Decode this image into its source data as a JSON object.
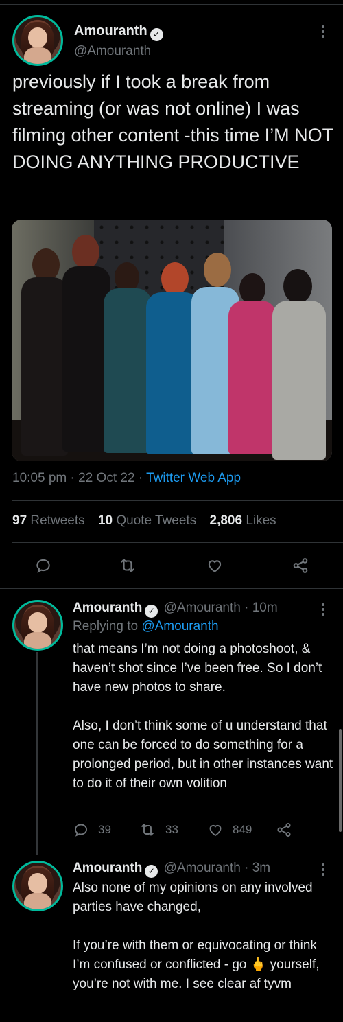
{
  "tweet": {
    "author_name": "Amouranth",
    "author_handle": "@Amouranth",
    "text": "previously if I took a break from streaming (or was not online) I was filming other content -this time I’M NOT DOING ANYTHING PRODUCTIVE",
    "time": "10:05 pm",
    "date": "22 Oct 22",
    "source": "Twitter Web App",
    "sep": "·",
    "stats": {
      "retweets_count": "97",
      "retweets_label": "Retweets",
      "quotes_count": "10",
      "quotes_label": "Quote Tweets",
      "likes_count": "2,806",
      "likes_label": "Likes"
    },
    "actions": [
      "reply-icon",
      "retweet-icon",
      "like-icon",
      "share-icon"
    ]
  },
  "replies": [
    {
      "author_name": "Amouranth",
      "author_handle": "@Amouranth",
      "time": "· 10m",
      "replying_prefix": "Replying to",
      "replying_to": "@Amouranth",
      "text": "that means I’m not doing a photoshoot, & haven’t shot since I’ve been free.  So I don’t have new photos to share.\n\nAlso, I don’t think some of u understand that one can be forced to do something for a prolonged period, but in other instances want to do it of their own volition",
      "reply_count": "39",
      "retweet_count": "33",
      "like_count": "849"
    },
    {
      "author_name": "Amouranth",
      "author_handle": "@Amouranth",
      "time": "· 3m",
      "text": "Also none of my opinions on any involved parties have changed,\n\nIf you’re with them or equivocating or think I’m confused or conflicted - go 🖕 yourself, you’re not with me.  I see clear af tyvm"
    }
  ],
  "colors": {
    "accent": "#1d9bf0",
    "avatar_ring": "#00ba9c",
    "muted": "#71767b",
    "background": "#000000"
  }
}
